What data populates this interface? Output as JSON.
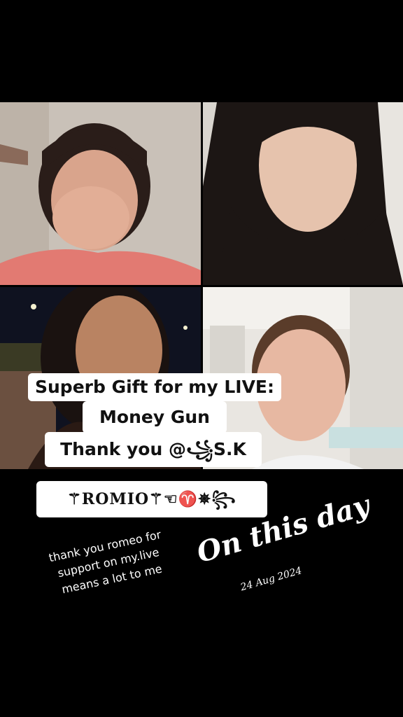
{
  "live_grid": {
    "participants": [
      {
        "name": "participant-1"
      },
      {
        "name": "participant-2"
      },
      {
        "name": "participant-3"
      },
      {
        "name": "participant-4"
      }
    ]
  },
  "gift_caption": {
    "line1": "Superb Gift for my LIVE:",
    "line2": "Money Gun",
    "line3": "Thank you @꧁S.K",
    "line4": "⚚ROMIO⚚☜♈✵꧂"
  },
  "note": {
    "line1": "thank you romeo for",
    "line2": "support on my.live",
    "line3": "means a lot to me"
  },
  "memory": {
    "title": "On this day",
    "date": "24 Aug 2024"
  }
}
